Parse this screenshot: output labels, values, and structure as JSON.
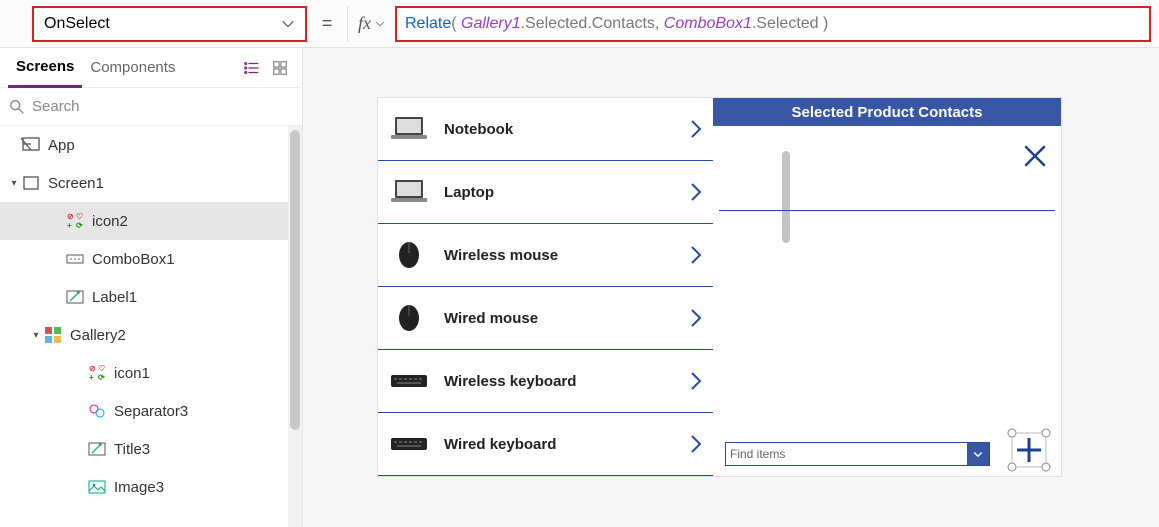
{
  "formula_bar": {
    "property": "OnSelect",
    "formula_tokens": [
      {
        "t": "Relate",
        "c": "blue"
      },
      {
        "t": "( ",
        "c": "grey"
      },
      {
        "t": "Gallery1",
        "c": "purple"
      },
      {
        "t": ".Selected.Contacts, ",
        "c": "grey"
      },
      {
        "t": "ComboBox1",
        "c": "purple"
      },
      {
        "t": ".Selected )",
        "c": "grey"
      }
    ],
    "equals": "="
  },
  "tree_tabs": {
    "screens": "Screens",
    "components": "Components"
  },
  "tree_search_placeholder": "Search",
  "tree": [
    {
      "id": "app",
      "label": "App",
      "kind": "app",
      "depth": 0,
      "caret": ""
    },
    {
      "id": "screen1",
      "label": "Screen1",
      "kind": "screen",
      "depth": 0,
      "caret": "▾"
    },
    {
      "id": "icon2",
      "label": "icon2",
      "kind": "addicon",
      "depth": 2,
      "caret": "",
      "selected": true
    },
    {
      "id": "combo1",
      "label": "ComboBox1",
      "kind": "combo",
      "depth": 2,
      "caret": ""
    },
    {
      "id": "label1",
      "label": "Label1",
      "kind": "label",
      "depth": 2,
      "caret": ""
    },
    {
      "id": "gallery2",
      "label": "Gallery2",
      "kind": "gallery",
      "depth": 1,
      "caret": "▾"
    },
    {
      "id": "icon1",
      "label": "icon1",
      "kind": "addicon",
      "depth": 3,
      "caret": ""
    },
    {
      "id": "sep3",
      "label": "Separator3",
      "kind": "separator",
      "depth": 3,
      "caret": ""
    },
    {
      "id": "title3",
      "label": "Title3",
      "kind": "label",
      "depth": 3,
      "caret": ""
    },
    {
      "id": "image3",
      "label": "Image3",
      "kind": "image",
      "depth": 3,
      "caret": ""
    }
  ],
  "canvas": {
    "header_title": "Selected Product Contacts",
    "products": [
      {
        "title": "Notebook",
        "icon": "laptop"
      },
      {
        "title": "Laptop",
        "icon": "laptop"
      },
      {
        "title": "Wireless mouse",
        "icon": "mouse"
      },
      {
        "title": "Wired mouse",
        "icon": "mouse"
      },
      {
        "title": "Wireless keyboard",
        "icon": "keyboard"
      },
      {
        "title": "Wired keyboard",
        "icon": "keyboard"
      }
    ],
    "combo_placeholder": "Find items"
  }
}
